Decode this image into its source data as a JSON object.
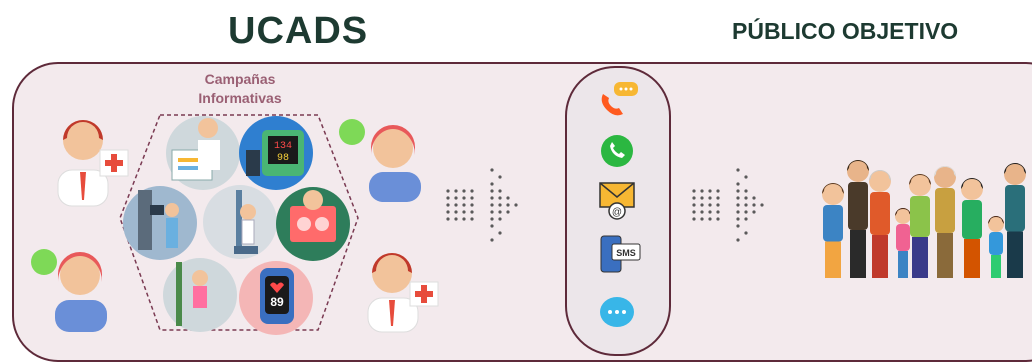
{
  "header": {
    "left_title": "UCADS",
    "right_title": "PÚBLICO OBJETIVO"
  },
  "campaign": {
    "label_line1": "Campañas",
    "label_line2": "Informativas",
    "monitor_reading_top": "134",
    "monitor_reading_bottom": "98",
    "watch_reading": "89"
  },
  "channels": {
    "items": [
      "phone-chat-icon",
      "whatsapp-icon",
      "email-icon",
      "sms-icon",
      "chat-bubble-icon"
    ],
    "sms_text": "SMS",
    "email_text": "@"
  },
  "colors": {
    "title": "#1d3a31",
    "panel_border": "#5e2a3a",
    "panel_fill": "#f3eaed",
    "whatsapp": "#2bb741",
    "email": "#f7b733",
    "chat": "#38b6e8",
    "phone": "#ff5a1f"
  }
}
